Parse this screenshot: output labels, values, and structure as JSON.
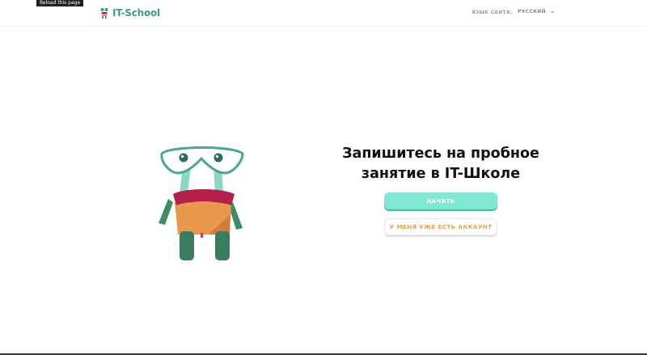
{
  "tooltip": "Reload this page",
  "header": {
    "logo_text": "IT-School",
    "lang_label": "ЯЗЫК САЙТА:",
    "lang_value": "РУССКИЙ"
  },
  "icons": {
    "logo": "robot-logo-icon",
    "lang_dropdown": "chevron-down-icon",
    "illustration": "robot-illustration"
  },
  "main": {
    "title_line1": "Запишитесь на пробное",
    "title_line2": "занятие в IT-Школе",
    "start_button": "НАЧАТЬ",
    "account_button": "У МЕНЯ УЖЕ ЕСТЬ АККАУНТ"
  },
  "colors": {
    "brand": "#3e9e7e",
    "primary_button": "#7ee8d2",
    "secondary_text": "#e0a05a"
  }
}
